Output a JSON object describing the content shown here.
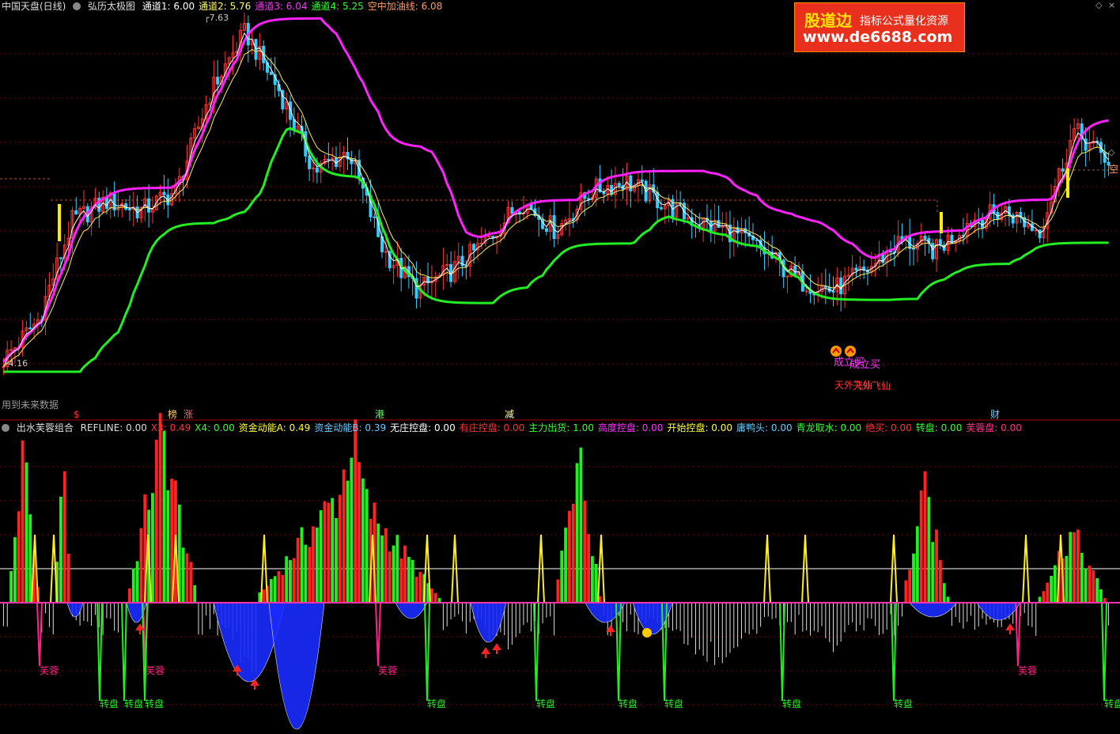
{
  "header": {
    "title": "中国天盘(日线)",
    "indicator_name": "弘历太极图",
    "channels": [
      {
        "label": "通道1: 6.00",
        "color": "#ffffff"
      },
      {
        "label": "通道2: 5.76",
        "color": "#ffff66"
      },
      {
        "label": "通道3: 6.04",
        "color": "#ff33ff"
      },
      {
        "label": "通道4: 5.25",
        "color": "#33ff33"
      },
      {
        "label": "空中加油线: 6.08",
        "color": "#ff9966"
      }
    ]
  },
  "logo": {
    "brand": "股道边",
    "tagline": "指标公式量化资源",
    "url": "www.de6688.com"
  },
  "main_chart": {
    "max_label": "7.63",
    "min_label": "4.16",
    "right_edge_label": "空",
    "future_data_note": "用到未来数据",
    "signal_labels": [
      "成立买",
      "成立买",
      "天外飞仙",
      "天外飞仙"
    ],
    "bottom_markers": [
      {
        "text": "$",
        "color": "#ff3333"
      },
      {
        "text": "榜",
        "color": "#ffcc66"
      },
      {
        "text": "涨",
        "color": "#ff6666"
      },
      {
        "text": "港",
        "color": "#66ff66"
      },
      {
        "text": "减",
        "color": "#ffff99"
      },
      {
        "text": "财",
        "color": "#66ccff"
      }
    ],
    "colors": {
      "channel_upper": "#ff22ff",
      "channel_lower": "#22ee22",
      "fast_line": "#ffffff",
      "slow_line": "#ffee55",
      "up_candle": "#ff3333",
      "down_candle": "#33ccff",
      "refuel_line": "#ff9966",
      "grid": "#7a0000"
    }
  },
  "sub_header": {
    "name": "出水芙蓉组合",
    "items": [
      {
        "label": "REFLINE: 0.00",
        "color": "#dddddd"
      },
      {
        "label": "X3: 0.49",
        "color": "#ff3333"
      },
      {
        "label": "X4: 0.00",
        "color": "#33ff33"
      },
      {
        "label": "资金动能A: 0.49",
        "color": "#ffff33"
      },
      {
        "label": "资金动能B: 0.39",
        "color": "#66ccff"
      },
      {
        "label": "无庄控盘: 0.00",
        "color": "#ffffff"
      },
      {
        "label": "有庄控盘: 0.00",
        "color": "#ff3333"
      },
      {
        "label": "主力出货: 1.00",
        "color": "#33ff33"
      },
      {
        "label": "高度控盘: 0.00",
        "color": "#ff33ff"
      },
      {
        "label": "开始控盘: 0.00",
        "color": "#ffff33"
      },
      {
        "label": "庸鸭头: 0.00",
        "color": "#66ccff"
      },
      {
        "label": "青龙取水: 0.00",
        "color": "#33ff33"
      },
      {
        "label": "绝买: 0.00",
        "color": "#ff3333"
      },
      {
        "label": "转盘: 0.00",
        "color": "#33ff33"
      },
      {
        "label": "芙蓉盘: 0.00",
        "color": "#ff3388"
      }
    ]
  },
  "sub_chart": {
    "furong_label": "芙蓉",
    "zhuanpan_label": "转盘",
    "colors": {
      "red_bar": "#ff2222",
      "green_bar": "#22ee22",
      "white_bar": "#dddddd",
      "blue_fill": "#1a2cff",
      "yellow_spike": "#ffee22",
      "pink_spike": "#ff2288",
      "green_spike": "#22ee22",
      "zero_line": "#ff33aa",
      "ref_line": "#ffffff"
    }
  },
  "chart_data": {
    "type": "candlestick",
    "title": "中国天盘(日线)",
    "price_max": 7.63,
    "price_min": 4.16,
    "channel_values": {
      "通道1": 6.0,
      "通道2": 5.76,
      "通道3": 6.04,
      "通道4": 5.25,
      "空中加油线": 6.08
    },
    "close_anchors": [
      4.2,
      4.6,
      5.6,
      5.8,
      5.7,
      5.9,
      6.9,
      7.5,
      6.9,
      6.1,
      6.3,
      5.3,
      4.9,
      5.1,
      5.4,
      5.8,
      5.5,
      5.9,
      6.0,
      5.8,
      5.6,
      5.5,
      5.3,
      5.0,
      4.9,
      5.1,
      5.4,
      5.3,
      5.6,
      5.7,
      5.5,
      6.5,
      6.2
    ],
    "indicator_series": [
      "X3",
      "X4",
      "资金动能A",
      "资金动能B"
    ],
    "indicator_values_last": {
      "REFLINE": 0.0,
      "X3": 0.49,
      "X4": 0.0,
      "资金动能A": 0.49,
      "资金动能B": 0.39
    }
  }
}
